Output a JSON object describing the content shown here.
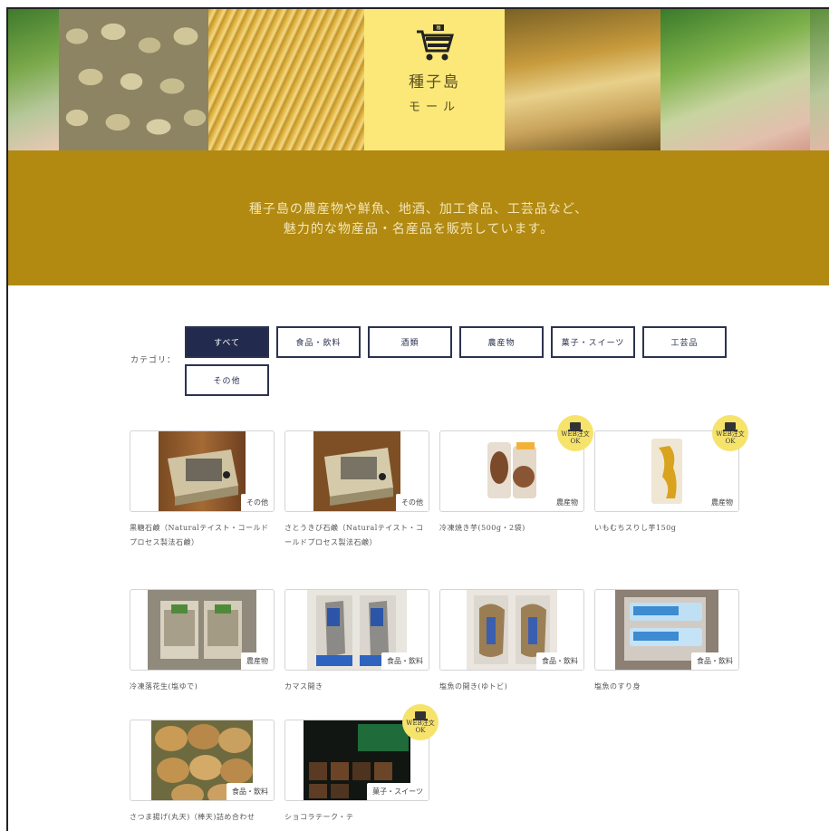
{
  "header": {
    "mall_title": "種子島",
    "mall_subtitle": "モール",
    "tagline_line1": "種子島の農産物や鮮魚、地酒、加工食品、工芸品など、",
    "tagline_line2": "魅力的な物産品・名産品を販売しています。"
  },
  "filters": {
    "label": "カテゴリ：",
    "categories": [
      "すべて",
      "食品・飲料",
      "酒類",
      "農産物",
      "菓子・スイーツ",
      "工芸品",
      "その他"
    ],
    "active": "すべて"
  },
  "badge": {
    "line1": "WEB注文",
    "line2": "OK"
  },
  "products": [
    {
      "name": "黒糖石鹸（Naturalテイスト・コールドプロセス製法石鹸）",
      "category": "その他",
      "web_order": false
    },
    {
      "name": "さとうきび石鹸（Naturalテイスト・コールドプロセス製法石鹸）",
      "category": "その他",
      "web_order": false
    },
    {
      "name": "冷凍焼き芋(500g・2袋)",
      "category": "農産物",
      "web_order": true
    },
    {
      "name": "いもむちスりし芋150g",
      "category": "農産物",
      "web_order": true
    },
    {
      "name": "冷凍落花生(塩ゆで)",
      "category": "農産物",
      "web_order": false
    },
    {
      "name": "カマス開き",
      "category": "食品・飲料",
      "web_order": false
    },
    {
      "name": "塩魚の開き(ゆトビ)",
      "category": "食品・飲料",
      "web_order": false
    },
    {
      "name": "塩魚のすり身",
      "category": "食品・飲料",
      "web_order": false
    },
    {
      "name": "さつま揚げ(丸天)（棒天)詰め合わせ",
      "category": "食品・飲料",
      "web_order": false
    },
    {
      "name": "ショコラテーク・テ",
      "category": "菓子・スイーツ",
      "web_order": true
    }
  ],
  "colors": {
    "band": "#b28a12",
    "banner": "#fbe878",
    "active_filter": "#222a4d",
    "badge": "#f6e36c"
  }
}
